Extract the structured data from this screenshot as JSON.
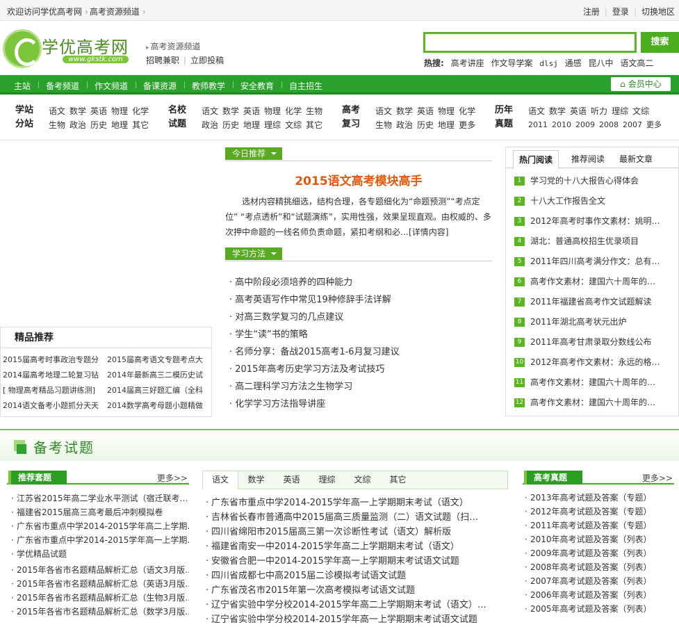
{
  "topbar": {
    "welcome": "欢迎访问学优高考网",
    "crumb": "高考资源频道",
    "register": "注册",
    "login": "登录",
    "switch_region": "切换地区"
  },
  "logo": {
    "name": "学优高考网",
    "url": "www.gkstk.com"
  },
  "channel": "高考资源频道",
  "recruit": "招聘兼职",
  "submit": "立即投稿",
  "search": {
    "value": "",
    "button": "搜索"
  },
  "hot": {
    "label": "热搜:",
    "items": [
      "高考讲座",
      "作文导学案",
      "dlsj",
      "通感",
      "昆八中",
      "语文高二"
    ]
  },
  "nav": {
    "items": [
      "主站",
      "备考频道",
      "作文频道",
      "备课资源",
      "教师教学",
      "安全教育",
      "自主招生"
    ],
    "member": "会员中心"
  },
  "subnav": [
    {
      "head1": "学站",
      "head2": "分站",
      "row1": [
        "语文",
        "数学",
        "英语",
        "物理",
        "化学"
      ],
      "row2": [
        "生物",
        "政治",
        "历史",
        "地理",
        "其它"
      ]
    },
    {
      "head1": "名校",
      "head2": "试题",
      "row1": [
        "语文",
        "数学",
        "英语",
        "物理",
        "化学",
        "生物"
      ],
      "row2": [
        "政治",
        "历史",
        "地理",
        "理综",
        "文综",
        "其它"
      ]
    },
    {
      "head1": "高考",
      "head2": "复习",
      "row1": [
        "语文",
        "数学",
        "英语",
        "物理",
        "化学"
      ],
      "row2": [
        "生物",
        "政治",
        "历史",
        "地理",
        "更多"
      ]
    },
    {
      "head1": "历年",
      "head2": "真题",
      "row1": [
        "语文",
        "数学",
        "英语",
        "听力",
        "理综",
        "文综"
      ],
      "row2": [
        "2011",
        "2010",
        "2009",
        "2008",
        "2007",
        "更多"
      ]
    }
  ],
  "picks": {
    "title": "精品推荐",
    "items": [
      "2015届高考时事政治专题分",
      "2015届高考语文专题考点大",
      "2014届高考地理二轮复习钻",
      "2014年最新高三二模历史试",
      "[ 物理高考精品习题讲练测]",
      "2014届高三好题汇编（全科",
      "2014语文备考小题抓分天天",
      "2014数学高考母题小题精做"
    ]
  },
  "today": {
    "tag": "今日推荐",
    "title": "2015语文高考模块高手",
    "desc": "选材内容精挑细选，结构合理，各专题细化为“命题预测”“考点定位” “考点透析”和“试题演练”，实用性强，效果呈现直观。由权威的、多次押中命题的一线名师负责命题，紧扣考纲和必…",
    "more": "[详情内容]"
  },
  "methods": {
    "tag": "学习方法",
    "items": [
      "高中阶段必须培养的四种能力",
      "高考英语写作中常见19种修辞手法详解",
      "对高三数学复习的几点建议",
      "学生“读”书的策略",
      "名师分享：备战2015高考1-6月复习建议",
      "2015年高考历史学习方法及考试技巧",
      "高二理科学习方法之生物学习",
      "化学学习方法指导讲座"
    ]
  },
  "rank": {
    "tabs": [
      "热门阅读",
      "推荐阅读",
      "最新文章"
    ],
    "items": [
      "学习党的十八大报告心得体会",
      "十八大工作报告全文",
      "2012年高考时事作文素材：姚明…",
      "湖北：普通高校招生优录项目",
      "2011年四川高考满分作文：总有…",
      "高考作文素材：建国六十周年的…",
      "2011年福建省高考作文试题解读",
      "2011年湖北高考状元出炉",
      "2011年高考甘肃录取分数线公布",
      "2012年高考作文素材：永远的格…",
      "高考作文素材：建国六十周年的…",
      "高考作文素材：建国六十周年的…"
    ]
  },
  "band": {
    "title": "备考试题"
  },
  "left_col": {
    "title": "推荐套题",
    "more": "更多>>",
    "items_a": [
      "江苏省2015年高二学业水平测试（宿迁联考…",
      "福建省2015届高三高考最后冲刺模拟卷",
      "广东省市重点中学2014-2015学年高二上学期…",
      "广东省市重点中学2014-2015学年高一上学期…",
      "学优精品试题"
    ],
    "items_b": [
      "2015年各省市名题精品解析汇总（语文3月版…",
      "2015年各省市名题精品解析汇总（英语3月版…",
      "2015年各省市名题精品解析汇总（生物3月版…",
      "2015年各省市名题精品解析汇总（数学3月版…"
    ]
  },
  "mid_col": {
    "tabs": [
      "语文",
      "数学",
      "英语",
      "理综",
      "文综",
      "其它"
    ],
    "items": [
      "广东省市重点中学2014-2015学年高一上学期期末考试（语文）",
      "吉林省长春市普通高中2015届高三质量监测（二）语文试题（扫…",
      "四川省绵阳市2015届高三第一次诊断性考试（语文）解析版",
      "福建省南安一中2014-2015学年高二上学期期末考试（语文）",
      "安徽省合肥一中2014-2015学年高一上学期期末考试语文试题",
      "四川省成都七中高2015届二诊模拟考试语文试题",
      "广东省茂名市2015年第一次高考模拟考试语文试题",
      "辽宁省实验中学分校2014-2015学年高二上学期期末考试（语文）…",
      "辽宁省实验中学分校2014-2015学年高一上学期期末考试语文试题"
    ]
  },
  "right_col": {
    "title": "高考真题",
    "more": "更多>>",
    "items": [
      "2013年高考试题及答案（专题）",
      "2012年高考试题及答案（专题）",
      "2011年高考试题及答案（专题）",
      "2010年高考试题及答案（列表）",
      "2009年高考试题及答案（列表）",
      "2008年高考试题及答案（列表）",
      "2007年高考试题及答案（列表）",
      "2006年高考试题及答案（列表）",
      "2005年高考试题及答案（列表）"
    ]
  }
}
